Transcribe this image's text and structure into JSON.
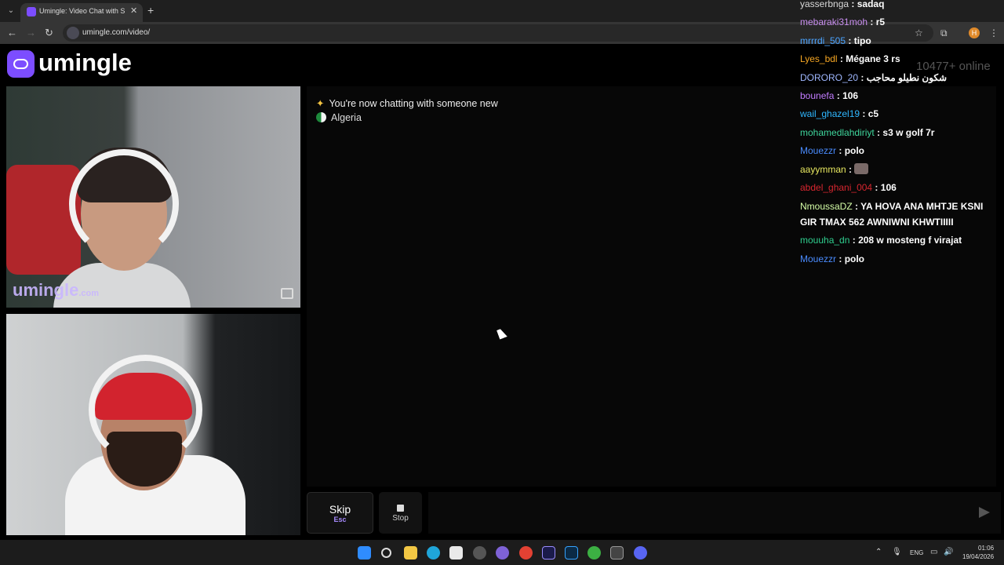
{
  "browser": {
    "tab_title": "Umingle: Video Chat with S",
    "url": "umingle.com/video/"
  },
  "site": {
    "logo_text": "umingle",
    "online_count": "10477+ online"
  },
  "video_top": {
    "watermark_text": "umingle",
    "watermark_suffix": ".com"
  },
  "chat": {
    "system_message": "You're now chatting with someone new",
    "country": "Algeria"
  },
  "overlay_messages": [
    {
      "user": "yasserbnga",
      "text": "sadaq",
      "color": "#d9d9d9"
    },
    {
      "user": "mebaraki31moh",
      "text": "r5",
      "color": "#c98ff0"
    },
    {
      "user": "mrrrdi_505",
      "text": "tipo",
      "color": "#4aa3ff"
    },
    {
      "user": "Lyes_bdl",
      "text": "Mégane 3 rs",
      "color": "#f5a623"
    },
    {
      "user": "DORORO_20",
      "text": "شكون نطيلو محاجب",
      "color": "#9fb7ff"
    },
    {
      "user": "bounefa",
      "text": "106",
      "color": "#c27cff"
    },
    {
      "user": "wail_ghazel19",
      "text": "c5",
      "color": "#2fb7ff"
    },
    {
      "user": "mohamedlahdiriyt",
      "text": "s3 w golf 7r",
      "color": "#3fd69c"
    },
    {
      "user": "Mouezzr",
      "text": "polo",
      "color": "#4a8cff"
    },
    {
      "user": "aayymman",
      "text": "",
      "color": "#e8e860",
      "emote": true
    },
    {
      "user": "abdel_ghani_004",
      "text": "106",
      "color": "#d7262f"
    },
    {
      "user": "NmoussaDZ",
      "text": "YA HOVA ANA MHTJE KSNI GIR TMAX 562 AWNIWNI KHWTIIIII",
      "color": "#d6ffa8",
      "wrap": true
    },
    {
      "user": "mouuha_dn",
      "text": "208 w mosteng f virajat",
      "color": "#2fcf8f"
    },
    {
      "user": "Mouezzr",
      "text": "polo",
      "color": "#4a8cff"
    }
  ],
  "controls": {
    "skip_label": "Skip",
    "skip_key": "Esc",
    "stop_label": "Stop"
  },
  "taskbar": {
    "lang": "ENG",
    "time": "01:06",
    "date": "19/04/2026"
  }
}
